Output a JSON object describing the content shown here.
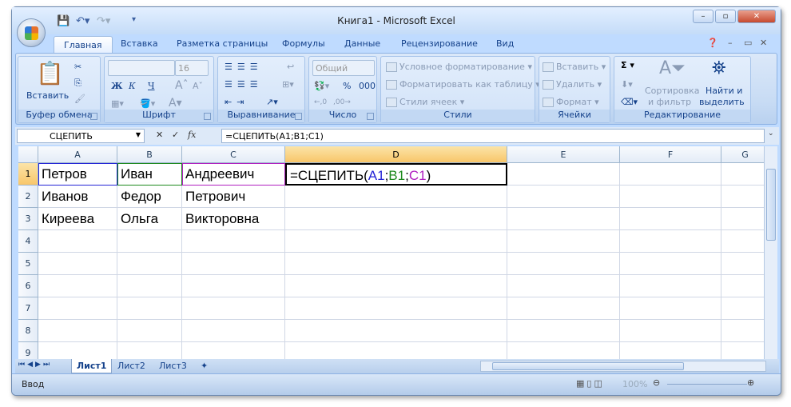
{
  "window": {
    "title": "Книга1 - Microsoft Excel"
  },
  "tabs": [
    "Главная",
    "Вставка",
    "Разметка страницы",
    "Формулы",
    "Данные",
    "Рецензирование",
    "Вид"
  ],
  "ribbon": {
    "clipboard": {
      "label": "Буфер обмена",
      "paste": "Вставить"
    },
    "font": {
      "label": "Шрифт",
      "font_size": "16",
      "bold": "Ж",
      "italic": "К",
      "underline": "Ч"
    },
    "alignment": {
      "label": "Выравнивание"
    },
    "number": {
      "label": "Число",
      "format": "Общий",
      "percent": "%",
      "thousands": "000"
    },
    "styles": {
      "label": "Стили",
      "conditional": "Условное форматирование",
      "as_table": "Форматировать как таблицу",
      "cell_styles": "Стили ячеек"
    },
    "cells": {
      "label": "Ячейки",
      "insert": "Вставить",
      "delete": "Удалить",
      "format": "Формат"
    },
    "editing": {
      "label": "Редактирование",
      "sigma": "Σ",
      "sort_line1": "Сортировка",
      "sort_line2": "и фильтр",
      "find_line1": "Найти и",
      "find_line2": "выделить"
    }
  },
  "formula_bar": {
    "name_box": "СЦЕПИТЬ",
    "fx": "fx",
    "formula": "=СЦЕПИТЬ(A1;B1;C1)"
  },
  "columns": [
    "A",
    "B",
    "C",
    "D",
    "E",
    "F",
    "G"
  ],
  "rows": [
    "1",
    "2",
    "3",
    "4",
    "5",
    "6",
    "7",
    "8",
    "9"
  ],
  "cells": [
    [
      "Петров",
      "Иван",
      "Андреевич"
    ],
    [
      "Иванов",
      "Федор",
      "Петрович"
    ],
    [
      "Киреева",
      "Ольга",
      "Викторовна"
    ]
  ],
  "edit_cell": {
    "prefix": "=СЦЕПИТЬ(",
    "ref1": "A1",
    "sep1": ";",
    "ref2": "B1",
    "sep2": ";",
    "ref3": "C1",
    "suffix": ")"
  },
  "colors": {
    "ref1": "#2424d6",
    "ref2": "#1e8a1e",
    "ref3": "#b020c0"
  },
  "sheets": [
    "Лист1",
    "Лист2",
    "Лист3"
  ],
  "status": {
    "mode": "Ввод",
    "zoom": "100%"
  }
}
